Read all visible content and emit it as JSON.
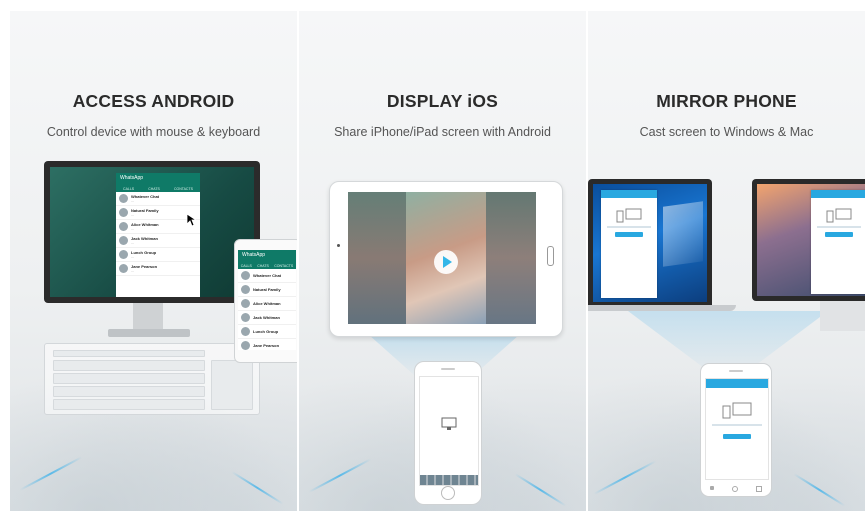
{
  "panels": [
    {
      "title": "ACCESS ANDROID",
      "subtitle": "Control device with mouse & keyboard"
    },
    {
      "title": "DISPLAY iOS",
      "subtitle": "Share iPhone/iPad screen with Android"
    },
    {
      "title": "MIRROR PHONE",
      "subtitle": "Cast screen to Windows & Mac"
    }
  ],
  "whatsapp": {
    "app_name": "WhatsApp",
    "tabs": [
      "CALLS",
      "CHATS",
      "CONTACTS"
    ],
    "chats": [
      "Whatever Chat",
      "Natural Family",
      "Alice Whitman",
      "Jack Whitman",
      "Lunch Group",
      "Jane Pearson"
    ]
  },
  "colors": {
    "accent": "#29a8e0",
    "whatsapp_green": "#0f7a67",
    "title_text": "#2b2b2b"
  },
  "icons": [
    "mouse-cursor-icon",
    "play-icon",
    "monitor-icon",
    "phone-icon",
    "home-button-icon"
  ]
}
